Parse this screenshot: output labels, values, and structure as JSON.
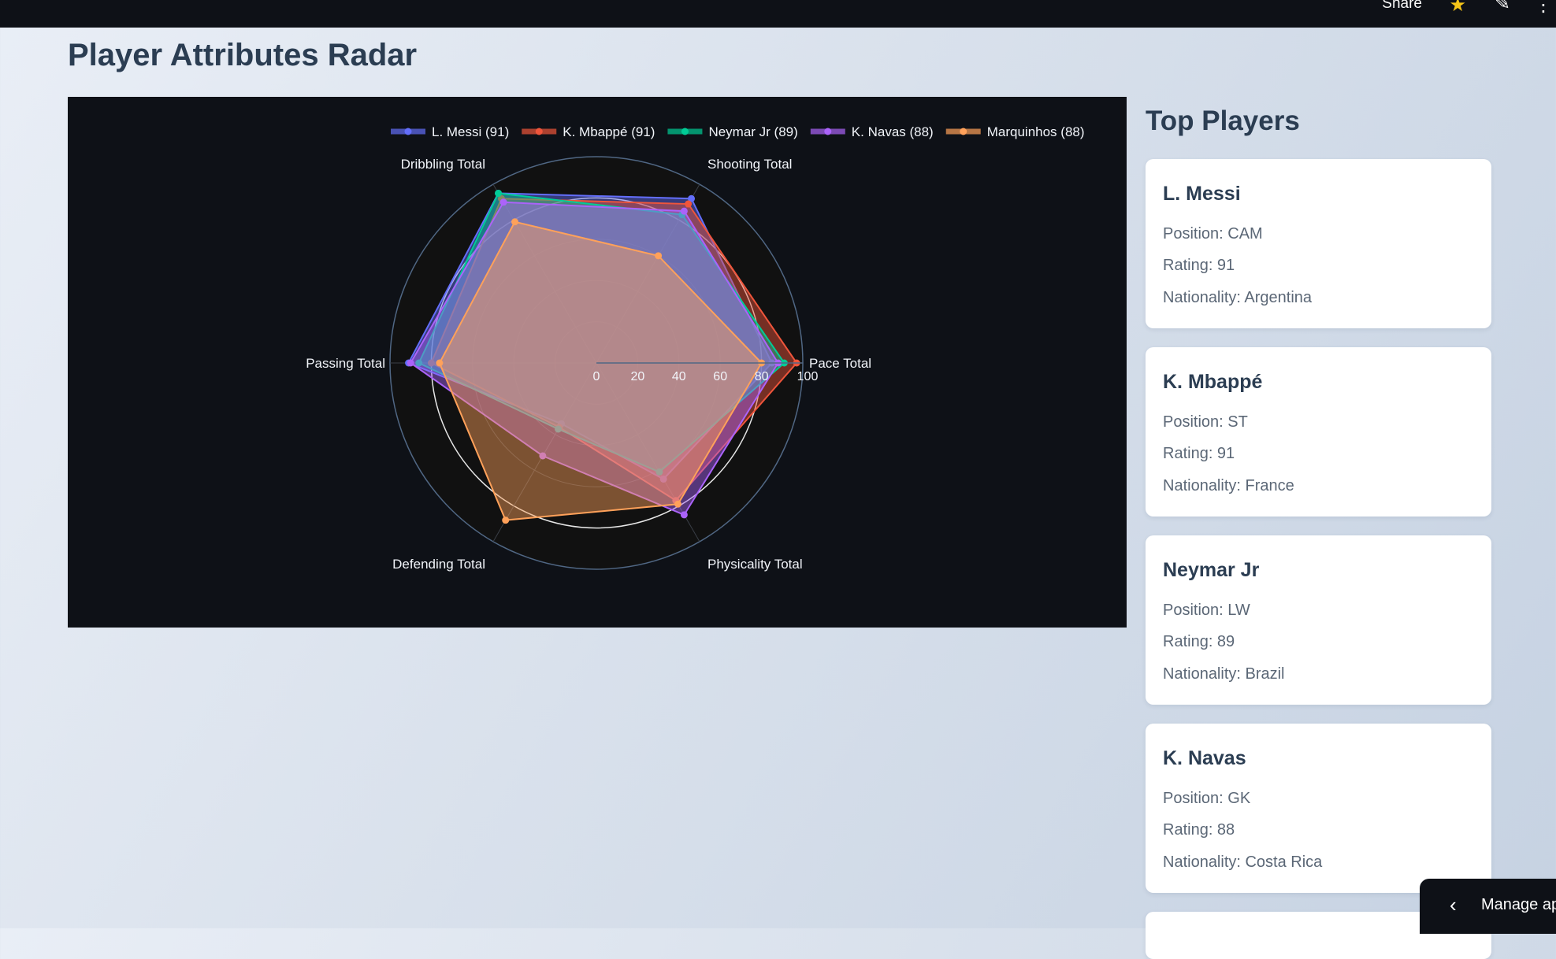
{
  "topbar": {
    "share_label": "Share",
    "star_icon": "star-icon",
    "edit_icon": "pencil-icon",
    "menu_icon": "more-vertical-icon"
  },
  "page": {
    "title": "Player Attributes Radar"
  },
  "sidebar": {
    "title": "Top Players",
    "cards": [
      {
        "name": "L. Messi",
        "position": "Position: CAM",
        "rating": "Rating: 91",
        "nationality": "Nationality: Argentina"
      },
      {
        "name": "K. Mbappé",
        "position": "Position: ST",
        "rating": "Rating: 91",
        "nationality": "Nationality: France"
      },
      {
        "name": "Neymar Jr",
        "position": "Position: LW",
        "rating": "Rating: 89",
        "nationality": "Nationality: Brazil"
      },
      {
        "name": "K. Navas",
        "position": "Position: GK",
        "rating": "Rating: 88",
        "nationality": "Nationality: Costa Rica"
      }
    ]
  },
  "manage_app": {
    "label": "Manage ap"
  },
  "chart_data": {
    "type": "radar",
    "axes": [
      "Pace Total",
      "Shooting Total",
      "Dribbling Total",
      "Passing Total",
      "Defending Total",
      "Physicality Total"
    ],
    "radial_range": [
      0,
      100
    ],
    "radial_ticks": [
      "0",
      "20",
      "40",
      "60",
      "80",
      "100"
    ],
    "legend_position": "top",
    "series": [
      {
        "name": "L. Messi (91)",
        "color": "#636efa",
        "values": [
          85,
          92,
          95,
          91,
          34,
          65
        ]
      },
      {
        "name": "K. Mbappé (91)",
        "color": "#ef553b",
        "values": [
          97,
          89,
          92,
          80,
          36,
          77
        ]
      },
      {
        "name": "Neymar Jr (89)",
        "color": "#00cc96",
        "values": [
          91,
          83,
          95,
          86,
          37,
          61
        ]
      },
      {
        "name": "K. Navas (88)",
        "color": "#ab63fa",
        "values": [
          88,
          85,
          90,
          90,
          52,
          85
        ]
      },
      {
        "name": "Marquinhos (88)",
        "color": "#ffa15a",
        "values": [
          80,
          60,
          79,
          76,
          88,
          79
        ]
      }
    ]
  }
}
